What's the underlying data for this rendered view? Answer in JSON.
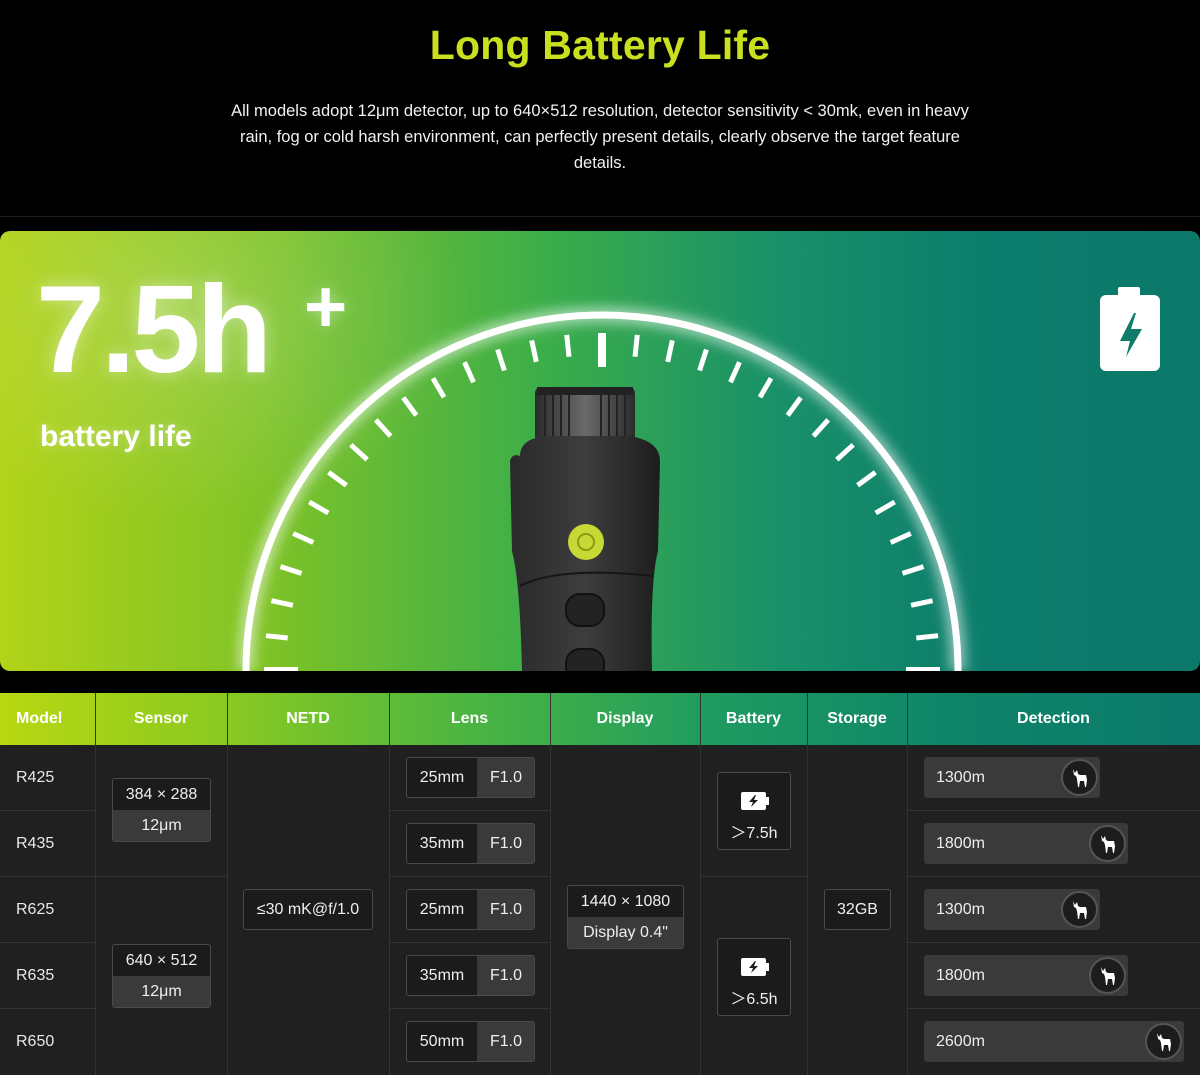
{
  "header": {
    "title": "Long Battery Life",
    "description": "All models adopt 12μm detector, up to 640×512 resolution, detector sensitivity < 30mk, even in heavy rain, fog or cold harsh environment, can perfectly present details, clearly observe the target feature details."
  },
  "banner": {
    "hours": "7.5h",
    "plus": "+",
    "label": "battery life",
    "icon": "battery-charging-icon",
    "colors": {
      "start": "#b2d318",
      "end": "#0b786a",
      "button": "#c6d834"
    }
  },
  "table": {
    "headers": [
      "Model",
      "Sensor",
      "NETD",
      "Lens",
      "Display",
      "Battery",
      "Storage",
      "Detection"
    ],
    "models": [
      "R425",
      "R435",
      "R625",
      "R635",
      "R650"
    ],
    "sensors": [
      {
        "resolution": "384 × 288",
        "pitch": "12μm"
      },
      {
        "resolution": "640 × 512",
        "pitch": "12μm"
      }
    ],
    "netd": "≤30 mK@f/1.0",
    "lenses": [
      {
        "focal": "25mm",
        "aperture": "F1.0"
      },
      {
        "focal": "35mm",
        "aperture": "F1.0"
      },
      {
        "focal": "25mm",
        "aperture": "F1.0"
      },
      {
        "focal": "35mm",
        "aperture": "F1.0"
      },
      {
        "focal": "50mm",
        "aperture": "F1.0"
      }
    ],
    "display": {
      "resolution": "1440 × 1080",
      "size": "Display 0.4\""
    },
    "battery": [
      {
        "value": "＞7.5h",
        "icon": "battery-charging-icon"
      },
      {
        "value": "＞6.5h",
        "icon": "battery-charging-icon"
      }
    ],
    "storage": "32GB",
    "detection": [
      {
        "distance": "1300m",
        "icon": "deer-icon"
      },
      {
        "distance": "1800m",
        "icon": "deer-icon"
      },
      {
        "distance": "1300m",
        "icon": "deer-icon"
      },
      {
        "distance": "1800m",
        "icon": "deer-icon"
      },
      {
        "distance": "2600m",
        "icon": "deer-icon"
      }
    ]
  }
}
